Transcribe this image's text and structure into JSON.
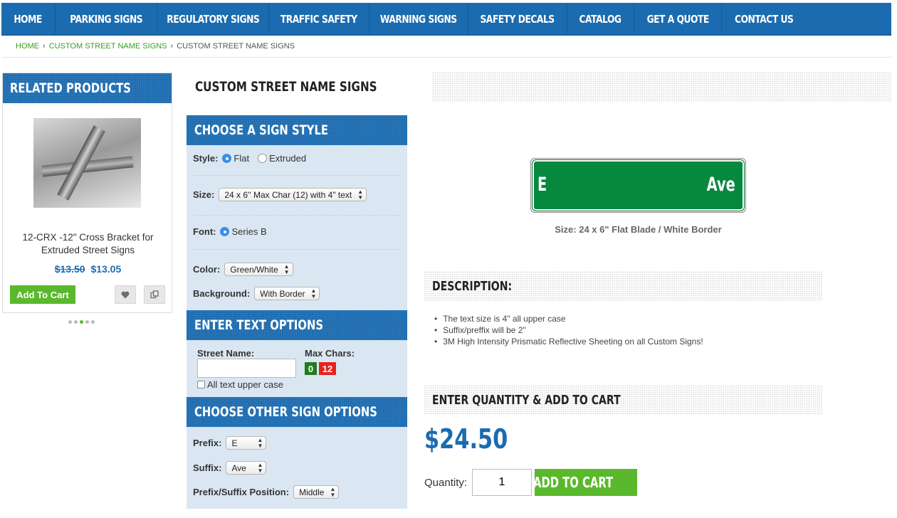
{
  "nav": {
    "items": [
      "HOME",
      "PARKING SIGNS",
      "REGULATORY SIGNS",
      "TRAFFIC SAFETY",
      "WARNING SIGNS",
      "SAFETY DECALS",
      "CATALOG",
      "GET A QUOTE",
      "CONTACT US"
    ]
  },
  "breadcrumb": {
    "home": "HOME",
    "category": "CUSTOM STREET NAME SIGNS",
    "current": "CUSTOM STREET NAME SIGNS",
    "sep": "›"
  },
  "related": {
    "heading": "RELATED PRODUCTS",
    "product_name": "12-CRX -12\" Cross Bracket for Extruded Street Signs",
    "old_price": "$13.50",
    "new_price": "$13.05",
    "add_to_cart": "Add To Cart",
    "wishlist_icon": "heart-icon",
    "compare_icon": "compare-icon",
    "carousel_dots": 5,
    "active_dot": 3
  },
  "page_title": "CUSTOM STREET NAME SIGNS",
  "options": {
    "style_heading": "CHOOSE A SIGN STYLE",
    "style_label": "Style:",
    "style_flat": "Flat",
    "style_extruded": "Extruded",
    "style_selected": "Flat",
    "size_label": "Size:",
    "size_value": "24 x 6'' Max Char (12) with 4\" text",
    "font_label": "Font:",
    "font_value": "Series B",
    "color_label": "Color:",
    "color_value": "Green/White",
    "background_label": "Background:",
    "background_value": "With Border",
    "text_heading": "ENTER TEXT OPTIONS",
    "street_name_label": "Street Name:",
    "street_name_value": "",
    "max_chars_label": "Max Chars:",
    "char_count": "0",
    "char_max": "12",
    "uppercase_label": "All text upper case",
    "other_heading": "CHOOSE OTHER SIGN OPTIONS",
    "prefix_label": "Prefix:",
    "prefix_value": "E",
    "suffix_label": "Suffix:",
    "suffix_value": "Ave",
    "position_label": "Prefix/Suffix Position:",
    "position_value": "Middle"
  },
  "sign": {
    "prefix": "E",
    "suffix": "Ave",
    "caption": "Size: 24 x 6\" Flat Blade / White Border",
    "color_bg": "#06883f",
    "color_text": "#ffffff"
  },
  "description": {
    "heading": "DESCRIPTION:",
    "items": [
      "The text size is 4\" all upper case",
      "Suffix/preffix will be 2\"",
      "3M High Intensity Prismatic Reflective Sheeting on all Custom Signs!"
    ]
  },
  "cart": {
    "heading": "ENTER QUANTITY & ADD TO CART",
    "price": "$24.50",
    "quantity_label": "Quantity:",
    "quantity_value": "1",
    "add_to_cart": "ADD TO CART",
    "cart_icon": "cart-icon"
  },
  "colors": {
    "brand_blue": "#1b6bb0",
    "accent_green": "#5ab82c",
    "panel_bg": "#dae7f2",
    "link_green": "#3a9d23"
  }
}
